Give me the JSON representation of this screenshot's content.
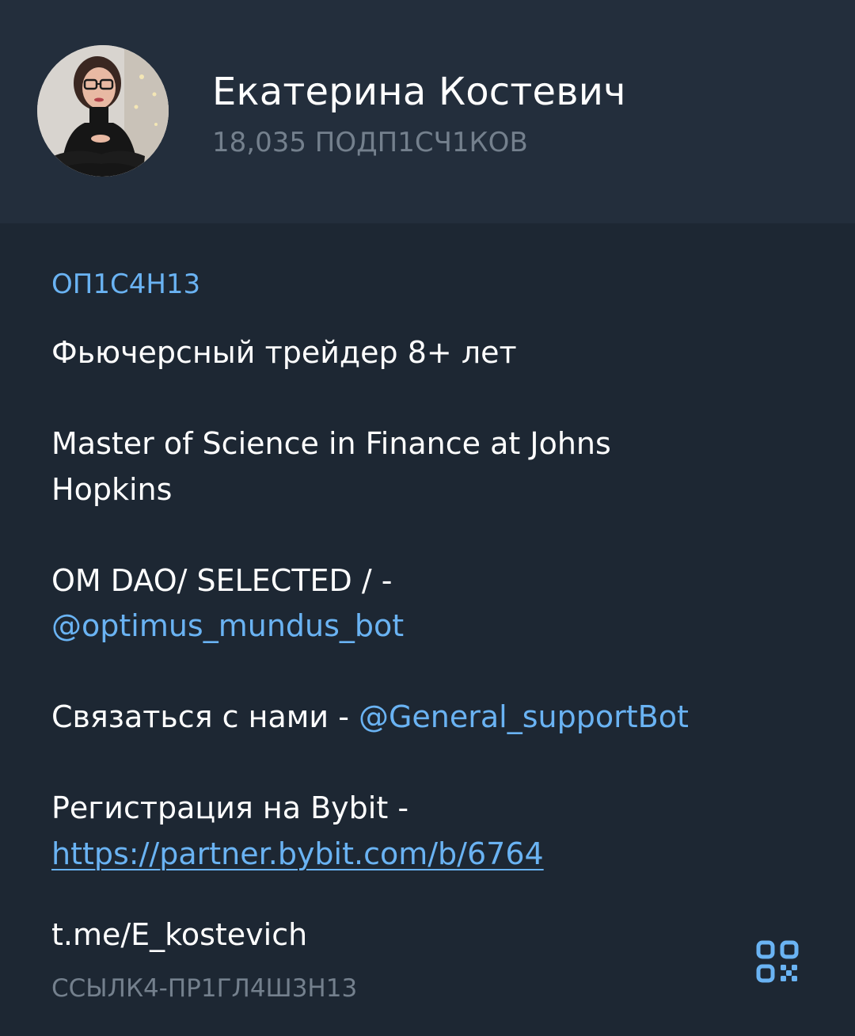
{
  "profile": {
    "name": "Екатерина Костевич",
    "subscribers": "18,035 ПОДП1СЧ1КОВ"
  },
  "about": {
    "section_title": "ОП1С4Н13",
    "line1": "Фьючерсный трейдер 8+ лет",
    "line2a": "Master of Science in Finance at Johns",
    "line2b": "Hopkins",
    "line3a": "OM DAO/ SELECTED / -",
    "line3_link": "@optimus_mundus_bot",
    "line4_text": "Связаться с нами - ",
    "line4_link": "@General_supportBot",
    "line5a": "Регистрация на Bybit -",
    "line5_link": "https://partner.bybit.com/b/6764"
  },
  "invite": {
    "username": "t.me/E_kostevich",
    "label": "ССЫЛК4-ПР1ГЛ4Ш3Н13",
    "qr_icon": "qr-code-icon"
  },
  "colors": {
    "background": "#1d2733",
    "header": "#232e3c",
    "accent": "#6ab3f3",
    "muted": "#74808d",
    "text": "#ffffff"
  }
}
